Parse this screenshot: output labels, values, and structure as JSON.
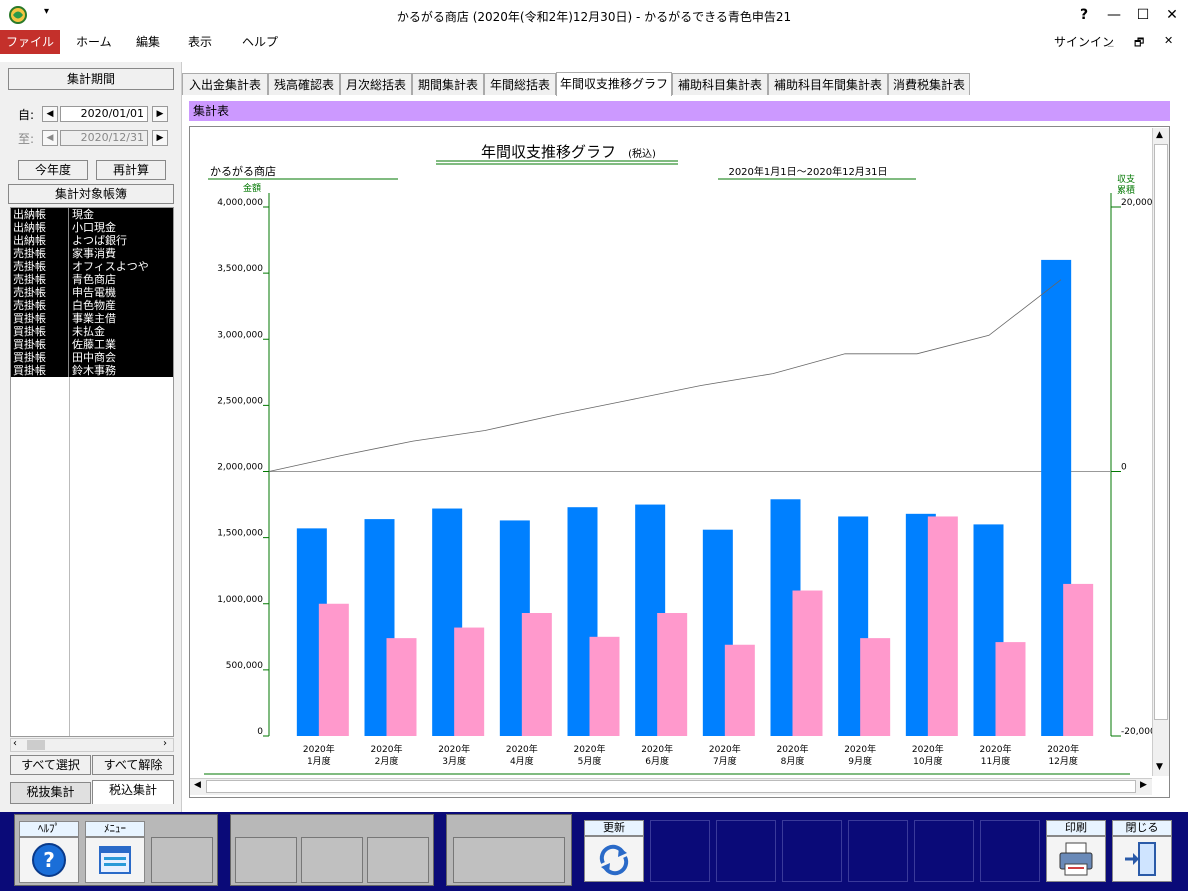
{
  "window": {
    "title": "かるがる商店 (2020年(令和2年)12月30日) - かるがるできる青色申告21",
    "help_glyph": "?",
    "minimize_glyph": "—",
    "maximize_glyph": "☐",
    "close_glyph": "✕",
    "restore_glyph": "🗗"
  },
  "menu": {
    "items": [
      "ファイル",
      "ホーム",
      "編集",
      "表示",
      "ヘルプ"
    ],
    "signin": "サインイン",
    "accent": "#c4302b"
  },
  "left": {
    "period_button": "集計期間",
    "from_label": "自:",
    "to_label": "至:",
    "from_date": "2020/01/01",
    "to_date": "2020/12/31",
    "this_year_button": "今年度",
    "recalc_button": "再計算",
    "ledger_header": "集計対象帳簿",
    "ledger_rows": [
      [
        "出納帳",
        "現金"
      ],
      [
        "出納帳",
        "小口現金"
      ],
      [
        "出納帳",
        "よつば銀行"
      ],
      [
        "売掛帳",
        "家事消費"
      ],
      [
        "売掛帳",
        "オフィスよつや"
      ],
      [
        "売掛帳",
        "青色商店"
      ],
      [
        "売掛帳",
        "申告電機"
      ],
      [
        "売掛帳",
        "白色物産"
      ],
      [
        "買掛帳",
        "事業主借"
      ],
      [
        "買掛帳",
        "未払金"
      ],
      [
        "買掛帳",
        "佐藤工業"
      ],
      [
        "買掛帳",
        "田中商会"
      ],
      [
        "買掛帳",
        "鈴木事務"
      ]
    ],
    "select_all_button": "すべて選択",
    "deselect_all_button": "すべて解除",
    "tax_excluded_tab": "税抜集計",
    "tax_included_tab": "税込集計"
  },
  "tabs": [
    "入出金集計表",
    "残高確認表",
    "月次総括表",
    "期間集計表",
    "年間総括表",
    "年間収支推移グラフ",
    "補助科目集計表",
    "補助科目年間集計表",
    "消費税集計表"
  ],
  "active_tab": 5,
  "section_title": "集計表",
  "section_color": "#cc99ff",
  "chart_data": {
    "type": "bar",
    "title": "年間収支推移グラフ",
    "title_suffix": "(税込)",
    "company": "かるがる商店",
    "period": "2020年1月1日～2020年12月31日",
    "ylabel": "金額",
    "y2label": "収支累積",
    "ylim": [
      0,
      4000000
    ],
    "y2lim": [
      -20000,
      20000
    ],
    "y_ticks": [
      "0",
      "500,000",
      "1,000,000",
      "1,500,000",
      "2,000,000",
      "2,500,000",
      "3,000,000",
      "3,500,000",
      "4,000,000"
    ],
    "y2_ticks": [
      "-20,000",
      "0",
      "20,000"
    ],
    "categories": [
      [
        "2020年",
        "1月度"
      ],
      [
        "2020年",
        "2月度"
      ],
      [
        "2020年",
        "3月度"
      ],
      [
        "2020年",
        "4月度"
      ],
      [
        "2020年",
        "5月度"
      ],
      [
        "2020年",
        "6月度"
      ],
      [
        "2020年",
        "7月度"
      ],
      [
        "2020年",
        "8月度"
      ],
      [
        "2020年",
        "9月度"
      ],
      [
        "2020年",
        "10月度"
      ],
      [
        "2020年",
        "11月度"
      ],
      [
        "2020年",
        "12月度"
      ]
    ],
    "series": [
      {
        "color": "#0080ff",
        "values": [
          1570000,
          1640000,
          1720000,
          1630000,
          1730000,
          1750000,
          1560000,
          1790000,
          1660000,
          1680000,
          1600000,
          3600000
        ]
      },
      {
        "color": "#ff99cc",
        "values": [
          1000000,
          740000,
          820000,
          930000,
          750000,
          930000,
          690000,
          1100000,
          740000,
          1660000,
          710000,
          1150000
        ]
      }
    ],
    "cumulative": {
      "color": "#666666",
      "values": [
        0,
        1200,
        2300,
        3100,
        4300,
        5400,
        6500,
        7400,
        8900,
        8900,
        10300,
        14500
      ]
    },
    "grid": false,
    "axis_color": "#007700"
  },
  "toolbar": {
    "help_label": "ﾍﾙﾌﾟ",
    "menu_label": "ﾒﾆｭｰ",
    "refresh_label": "更新",
    "print_label": "印刷",
    "close_label": "閉じる",
    "bg_color": "#0a0a78"
  }
}
